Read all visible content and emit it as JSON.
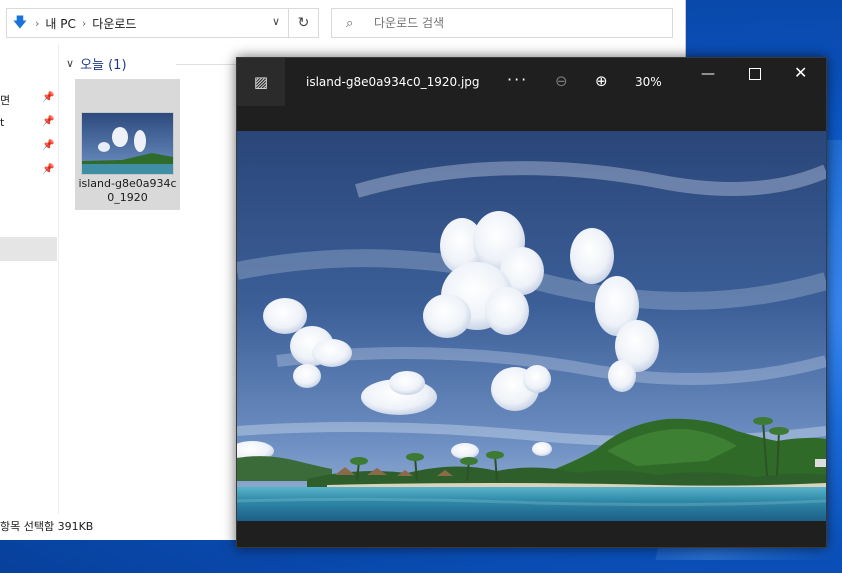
{
  "explorer": {
    "breadcrumb": [
      "내 PC",
      "다운로드"
    ],
    "search_placeholder": "다운로드 검색",
    "nav_items": [
      "면",
      "t",
      "",
      ""
    ],
    "group_header": "오늘 (1)",
    "file": {
      "name": "island-g8e0a934c0_1920"
    },
    "status": "항목 선택함 391KB"
  },
  "viewer": {
    "filename": "island-g8e0a934c0_1920.jpg",
    "zoom": "30%",
    "more_label": "···"
  },
  "icons": {
    "pc": "pc-download-icon",
    "dropdown": "chevron-down-icon",
    "refresh": "refresh-icon",
    "search": "search-icon",
    "pin": "pin-icon",
    "gallery": "gallery-icon",
    "zoom_out": "zoom-out-icon",
    "zoom_in": "zoom-in-icon",
    "minimize": "minimize-icon",
    "maximize": "maximize-icon",
    "close": "close-icon"
  },
  "colors": {
    "desktop": "#0a56c8",
    "viewer_bg": "#1f1f1f",
    "selection": "#d9d9d9",
    "group_header": "#1e3a8a"
  }
}
